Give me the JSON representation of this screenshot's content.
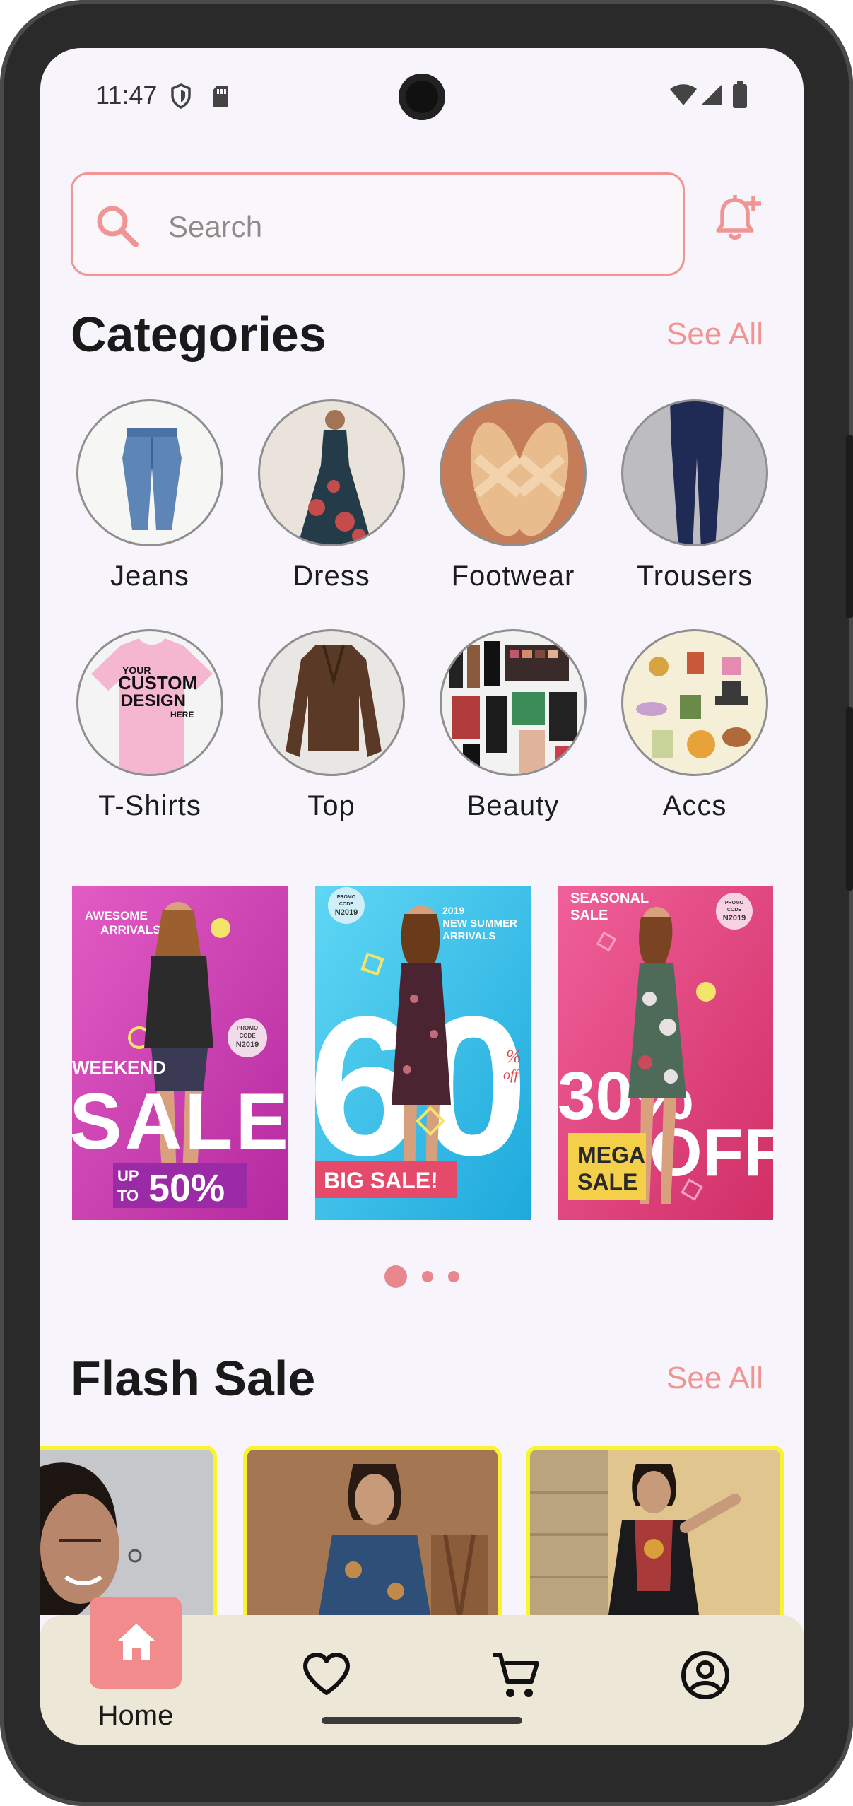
{
  "status_bar": {
    "time": "11:47",
    "icons": [
      "shield-icon",
      "sim-card-icon",
      "wifi-icon",
      "cell-signal-icon",
      "battery-icon"
    ]
  },
  "search": {
    "placeholder": "Search",
    "icon": "search-icon",
    "accent": "#f19494"
  },
  "notifications": {
    "icon": "bell-plus-icon"
  },
  "categories": {
    "title": "Categories",
    "see_all": "See All",
    "items": [
      {
        "label": "Jeans"
      },
      {
        "label": "Dress"
      },
      {
        "label": "Footwear"
      },
      {
        "label": "Trousers"
      },
      {
        "label": "T-Shirts",
        "image_text": [
          "YOUR",
          "CUSTOM",
          "DESIGN",
          "HERE"
        ]
      },
      {
        "label": "Top"
      },
      {
        "label": "Beauty"
      },
      {
        "label": "Accs"
      }
    ]
  },
  "banners": [
    {
      "top_text": [
        "AWESOME",
        "ARRIVALS"
      ],
      "badge": [
        "PROMO",
        "CODE",
        "N2019"
      ],
      "weekend": "WEEKEND",
      "big": "SALE",
      "up_to": [
        "UP",
        "TO"
      ],
      "percent": "50%",
      "color": "#d93fb2"
    },
    {
      "badge": [
        "PROMO",
        "CODE",
        "N2019"
      ],
      "top_text": [
        "2019",
        "NEW SUMMER",
        "ARRIVALS"
      ],
      "big": "60",
      "pct": "%",
      "off": "off",
      "tag": "BIG SALE!",
      "color": "#2fc3ea"
    },
    {
      "top_text": [
        "SEASONAL",
        "SALE"
      ],
      "badge": [
        "PROMO",
        "CODE",
        "N2019"
      ],
      "big": "30%",
      "off": "OFF",
      "mega": [
        "MEGA",
        "SALE"
      ],
      "color": "#e43f7a"
    }
  ],
  "carousel": {
    "page_count": 3,
    "active_index": 0
  },
  "flash_sale": {
    "title": "Flash Sale",
    "see_all": "See All",
    "card_border": "#f8f431"
  },
  "bottom_nav": {
    "items": [
      {
        "label": "Home",
        "icon": "home-icon",
        "active": true
      },
      {
        "icon": "heart-icon"
      },
      {
        "icon": "cart-icon"
      },
      {
        "icon": "account-icon"
      }
    ],
    "active_color": "#f28b8b",
    "background": "#ece7d6"
  }
}
